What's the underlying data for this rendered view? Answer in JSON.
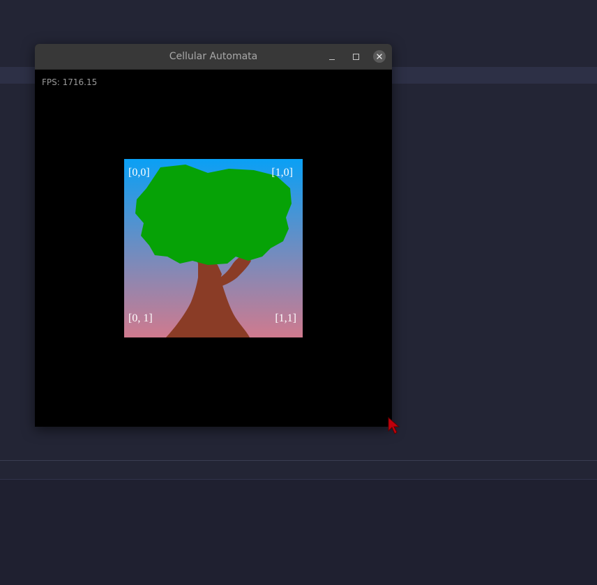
{
  "window": {
    "title": "Cellular Automata",
    "minimize_icon": "minimize-icon",
    "maximize_icon": "maximize-icon",
    "close_icon": "close-icon"
  },
  "overlay": {
    "fps": "FPS: 1716.15"
  },
  "scene": {
    "labels": {
      "top_left": "[0,0]",
      "top_right": "[1,0]",
      "bottom_left": "[0, 1]",
      "bottom_right": "[1,1]"
    },
    "colors": {
      "sky_top": "#0aa0f5",
      "sky_bottom": "#d07a8e",
      "foliage": "#06a206",
      "trunk": "#8a3c26"
    }
  },
  "cursor": {
    "icon": "arrow-cursor-icon",
    "color": "#c0000c"
  }
}
